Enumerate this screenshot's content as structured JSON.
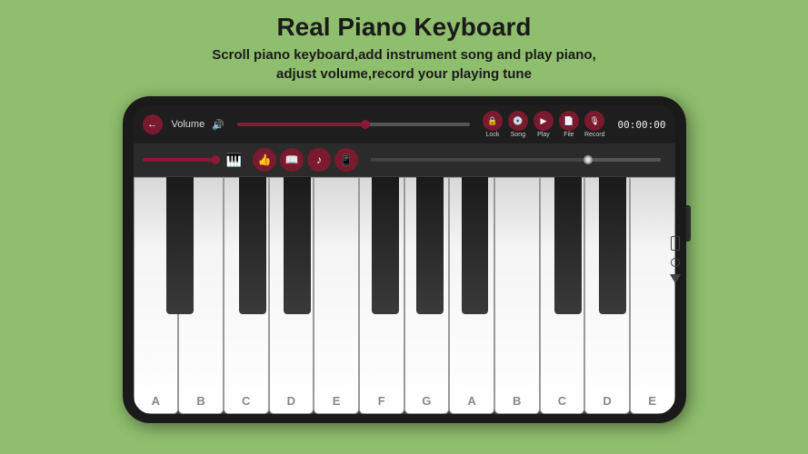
{
  "header": {
    "title": "Real Piano Keyboard",
    "subtitle_line1": "Scroll piano keyboard,add instrument song and play piano,",
    "subtitle_line2": "adjust volume,record your playing tune"
  },
  "phone": {
    "top_bar": {
      "volume_label": "Volume",
      "timer": "00:00:00",
      "controls": [
        {
          "id": "lock",
          "label": "Lock",
          "icon": "🔒"
        },
        {
          "id": "song",
          "label": "Song",
          "icon": "💿"
        },
        {
          "id": "play",
          "label": "Play",
          "icon": "▶"
        },
        {
          "id": "file",
          "label": "File",
          "icon": "📄"
        },
        {
          "id": "record",
          "label": "Record",
          "icon": "🎙"
        }
      ]
    },
    "white_keys": [
      {
        "label": "A"
      },
      {
        "label": "B"
      },
      {
        "label": "C"
      },
      {
        "label": "D"
      },
      {
        "label": "E"
      },
      {
        "label": "F"
      },
      {
        "label": "G"
      },
      {
        "label": "A"
      },
      {
        "label": "B"
      },
      {
        "label": "C"
      },
      {
        "label": "D"
      },
      {
        "label": "E"
      }
    ],
    "action_buttons": [
      {
        "icon": "👍"
      },
      {
        "icon": "📖"
      },
      {
        "icon": "🎵"
      },
      {
        "icon": "📱"
      }
    ]
  },
  "colors": {
    "bg": "#8fbe6e",
    "accent": "#7a1a2e",
    "phone_bg": "#1a1a1a",
    "screen_bg": "#2b2b2b"
  }
}
